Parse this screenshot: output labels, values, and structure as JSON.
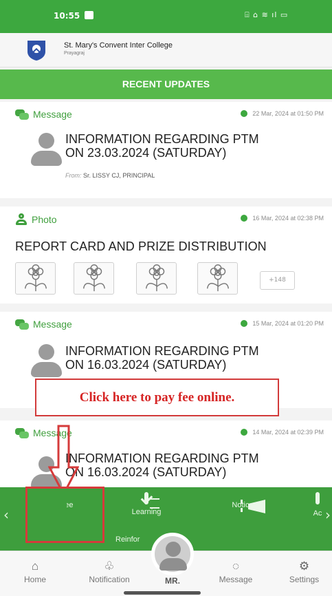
{
  "status_bar": {
    "time": "10:55",
    "indicators": "⌹ ⌂ ≋ ıl ▭"
  },
  "school": {
    "name": "St. Mary's Convent Inter College",
    "city": "Prayagraj"
  },
  "section_title": "RECENT UPDATES",
  "updates": [
    {
      "type": "Message",
      "date": "22 Mar, 2024 at 01:50 PM",
      "title_line1": "INFORMATION REGARDING PTM",
      "title_line2": "ON 23.03.2024 (SATURDAY)",
      "from_label": "From:",
      "from_name": "Sr. LISSY CJ, PRINCIPAL"
    },
    {
      "type": "Photo",
      "date": "16 Mar, 2024 at 02:38 PM",
      "title": "REPORT CARD AND PRIZE DISTRIBUTION",
      "more_count": "+148"
    },
    {
      "type": "Message",
      "date": "15 Mar, 2024 at 01:20 PM",
      "title_line1": "INFORMATION REGARDING PTM",
      "title_line2": "ON 16.03.2024 (SATURDAY)"
    },
    {
      "type": "Message",
      "date": "14 Mar, 2024 at 02:39 PM",
      "title_line1": "INFORMATION REGARDING PTM",
      "title_line2": "ON 16.03.2024 (SATURDAY)"
    }
  ],
  "callout_text": "Click here to pay fee online.",
  "shortcuts": {
    "prev": "‹",
    "next": "›",
    "fee": "Fee",
    "learning": "Learning",
    "learning_sub": "Reinfor",
    "notice": "Notice",
    "partial": "Ac"
  },
  "bottom_nav": {
    "home": "Home",
    "notification": "Notification",
    "center": "MR.",
    "message": "Message",
    "settings": "Settings"
  },
  "colors": {
    "brand_green": "#3e9e3d",
    "header_green": "#57b94c",
    "highlight_red": "#d53b3b"
  },
  "icons": [
    "school-logo-icon",
    "chat-icon",
    "clock-icon",
    "photo-icon",
    "wallet-icon",
    "learning-icon",
    "megaphone-icon",
    "phone-icon",
    "home-icon",
    "notification-icon",
    "avatar-icon",
    "message-icon",
    "settings-icon",
    "down-arrow-icon"
  ]
}
